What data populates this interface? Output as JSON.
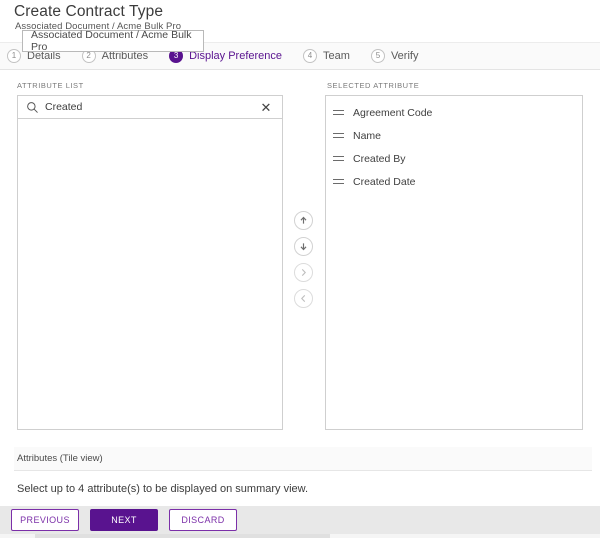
{
  "header": {
    "title": "Create Contract Type",
    "breadcrumb": "Associated Document / Acme Bulk Pro"
  },
  "tooltip": {
    "text": "Associated Document / Acme Bulk Pro"
  },
  "stepper": {
    "steps": [
      {
        "num": "1",
        "label": "Details",
        "active": false
      },
      {
        "num": "2",
        "label": "Attributes",
        "active": false
      },
      {
        "num": "3",
        "label": "Display Preference",
        "active": true
      },
      {
        "num": "4",
        "label": "Team",
        "active": false
      },
      {
        "num": "5",
        "label": "Verify",
        "active": false
      }
    ]
  },
  "attribute_list": {
    "label": "ATTRIBUTE LIST",
    "search": {
      "value": "Created",
      "placeholder": "Search",
      "search_icon": "search-icon",
      "clear_icon": "close-icon",
      "clear_glyph": "✕"
    },
    "items": []
  },
  "selected_attribute": {
    "label": "SELECTED ATTRIBUTE",
    "items": [
      {
        "label": "Agreement Code",
        "handle_icon": "drag-handle-icon"
      },
      {
        "label": "Name",
        "handle_icon": "drag-handle-icon"
      },
      {
        "label": "Created By",
        "handle_icon": "drag-handle-icon"
      },
      {
        "label": "Created Date",
        "handle_icon": "drag-handle-icon"
      }
    ]
  },
  "transfer_buttons": [
    {
      "name": "move-up-button",
      "icon": "arrow-up-icon"
    },
    {
      "name": "move-down-button",
      "icon": "arrow-down-icon"
    },
    {
      "name": "move-right-button",
      "icon": "chevron-right-icon"
    },
    {
      "name": "move-left-button",
      "icon": "chevron-left-icon"
    }
  ],
  "tile_section": {
    "title": "Attributes (Tile view)",
    "hint": "Select up to 4 attribute(s) to be displayed on summary view."
  },
  "footer": {
    "previous_label": "PREVIOUS",
    "next_label": "NEXT",
    "discard_label": "DISCARD"
  },
  "colors": {
    "accent": "#59138f",
    "accent_light": "#7b2fa8",
    "border": "#cfcfcf",
    "footer_bg": "#e8e8e8"
  }
}
